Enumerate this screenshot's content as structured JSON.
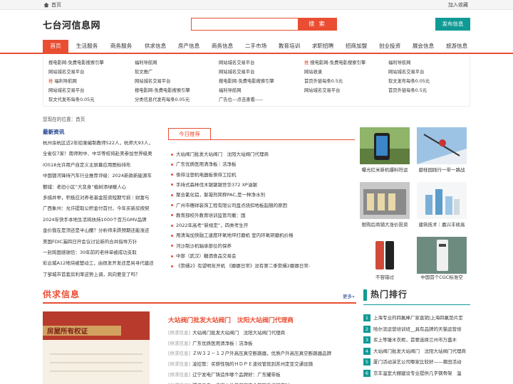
{
  "topbar": {
    "home": "首页",
    "favorite": "加入收藏"
  },
  "header": {
    "logo": "七台河信息网",
    "search_placeholder": "",
    "search_button": "搜 索",
    "post_button": "发布信息"
  },
  "nav": [
    "首页",
    "生活服务",
    "商务服务",
    "供求信息",
    "房产信息",
    "商务信息",
    "二手市场",
    "教育培训",
    "求职招聘",
    "招商加盟",
    "创业投资",
    "展会信息",
    "旅游信息"
  ],
  "links": [
    [
      "搜电影网-免费电影搜索引擎",
      "福利导航网",
      "网站城名交易平台",
      "搜电影网-免费电影搜索引擎",
      "福利导航网"
    ],
    [
      "网站城名交易平台",
      "软文推广",
      "网站城名交易平台",
      "网站收录",
      "网站城名交易平台"
    ],
    [
      "福利导航网",
      "网站城名交易平台",
      "搜电影网-免费电影搜索引擎",
      "首页外链每条0.5元",
      "软文发布每条0.05元"
    ],
    [
      "网站城名交易平台",
      "搜电影网-免费电影搜索引擎",
      "福利导航网",
      "网站城名交易平台",
      "首页外链每条0.5元"
    ],
    [
      "软文代发布每条0.05元",
      "分类信息代发布每条0.05元",
      "广告位---点击查看-----",
      "",
      ""
    ]
  ],
  "hot_marks": [
    [
      false,
      false,
      false,
      true,
      false
    ],
    [
      false,
      false,
      false,
      false,
      false
    ],
    [
      true,
      false,
      false,
      false,
      false
    ]
  ],
  "breadcrumb": "您现在的位置：首页",
  "news": {
    "title": "最新资讯",
    "items": [
      "杭州余杭区近2年招录编制教师522人，杭师大93人，",
      "全省仅7家！南师附中、中华等校将赴美参加世界级奥",
      "iOS18允许用户自定义主屏幕应用图标排布",
      "中国镀河锋持汽车行业推荐评级：2024新款新能源车",
      "鄞城：老旧小区“大变身”植树添绿暖人心",
      "多措并举，积极应对养老基金投资短期亏损｜财富与",
      "广西象州：允许提取公积金付首付，今年买新房按契",
      "2024年快手本地生活将扶持1000个百万GMV品牌",
      "金价我在是顶还是半山腰？分析师未跌预期还能涨还",
      "美国FDIC漏四日开会议讨论新的合并指导方针",
      "一封跨国感谢信：30年前的老伴单被成功支取",
      "彩云城A12地块被楚动工，由很发开发还是另寻代建还",
      "了邹城市首套房利率逆势上调，风向要变了吗？"
    ]
  },
  "recommend": {
    "tab": "今日推荐",
    "items": [
      "大站阀门批发大站阀门　沈阳大站阀门代理商",
      "广东优质医用清净板｜洁净板",
      "傢俳注塑机电器板傢俳工控机",
      "手持式森林伐木锯锯锯世华372 XP油锯",
      "聚合氯化铝，絮凝剂简称PAC,是一种净水剂",
      "广州市穗祥装饰工程有限公司盘点烧扣地板起翘的原因",
      "教育部校外教育培训监管司撤：国",
      "2022年高考“新规定”，四类考生开",
      "用清淘加快融工速度环氧地坪打磨机 室内环氧研磨机价格",
      "河沙制沙机轴承部位的保养",
      "中部（武汉）糖酒食品交易会",
      "《赘婿2》有望明年开机 《娜娜日常》没有第二季赘婿2娜娜日常-"
    ]
  },
  "thumbs": [
    {
      "caption": "曝光红米新机爆料符运"
    },
    {
      "caption": "碧桂园践行一带一路战"
    },
    {
      "caption": "限购后商铺大涨价投资"
    },
    {
      "caption": "建筑技术｜嘉兴丰收高"
    },
    {
      "caption": "不容错过"
    },
    {
      "caption": "中国首个CGC标准空"
    }
  ],
  "supply": {
    "title": "供求信息",
    "more": "更多»",
    "image_text": "房屋所有权证",
    "headline": "大站阀门批发大站阀门　沈阳大站阀门代理商",
    "tag": "[供求信息]",
    "items": [
      "大站阀门批发大站阀门　沈阳大站阀门代理商",
      "广东优质医用清净板｜洁净板",
      "ＺＷ３２－１２户外高压真空断路器，优质户外高压真空断路器品牌",
      "凌控管：买轿性强的ＨＤＰＥ波纹管就到苏州定亚交通设施",
      "辽宁发电厂铸造件哪个品牌好：广东耀带板",
      "腾讯云盘　绝密文件的保密安全管理系统的实时"
    ]
  },
  "hot_rank": {
    "title": "热门排行",
    "items": [
      "上海专业的四氟棒厂家直销|上海四氟垫片定",
      "哈尔滨运营培训班__具有品牌的天猫运营培",
      "买上等锤木衣柜，首要选择兰州市万盛木",
      "大站阀门批发大站阀门　沈阳大站阀门代理商",
      "厦门活动演艺公司哪家比较好——莆田活动",
      "京丰温室大棚建设专业提供几字钢骨架　温"
    ]
  }
}
